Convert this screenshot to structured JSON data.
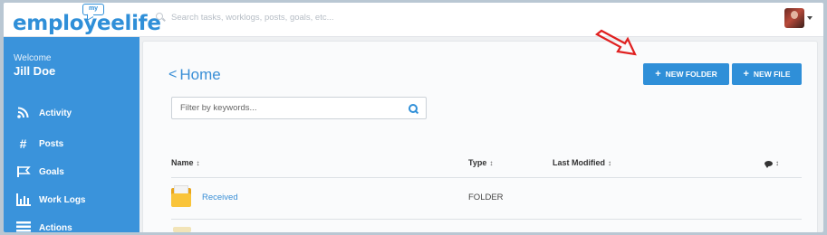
{
  "brand": {
    "logo_text": "employeelife",
    "logo_badge": "my"
  },
  "search": {
    "placeholder": "Search tasks, worklogs, posts, goals, etc..."
  },
  "sidebar": {
    "welcome": "Welcome",
    "user_name": "Jill Doe",
    "items": [
      {
        "label": "Activity",
        "icon": "rss-icon"
      },
      {
        "label": "Posts",
        "icon": "hash-icon"
      },
      {
        "label": "Goals",
        "icon": "flag-icon"
      },
      {
        "label": "Work Logs",
        "icon": "bar-chart-icon"
      },
      {
        "label": "Actions",
        "icon": "list-icon"
      }
    ]
  },
  "main": {
    "title": "Home",
    "back_glyph": "<",
    "new_folder_label": "NEW FOLDER",
    "new_file_label": "NEW FILE",
    "filter_placeholder": "Filter by keywords...",
    "columns": {
      "name": "Name",
      "type": "Type",
      "last_modified": "Last Modified",
      "sort_glyph": "↕"
    },
    "rows": [
      {
        "name": "Received",
        "type": "FOLDER",
        "last_modified": ""
      }
    ]
  },
  "colors": {
    "accent": "#2f8fd8",
    "sidebar_bg": "#3a93db",
    "annotation_arrow": "#e02020",
    "folder": "#f9c43a"
  }
}
